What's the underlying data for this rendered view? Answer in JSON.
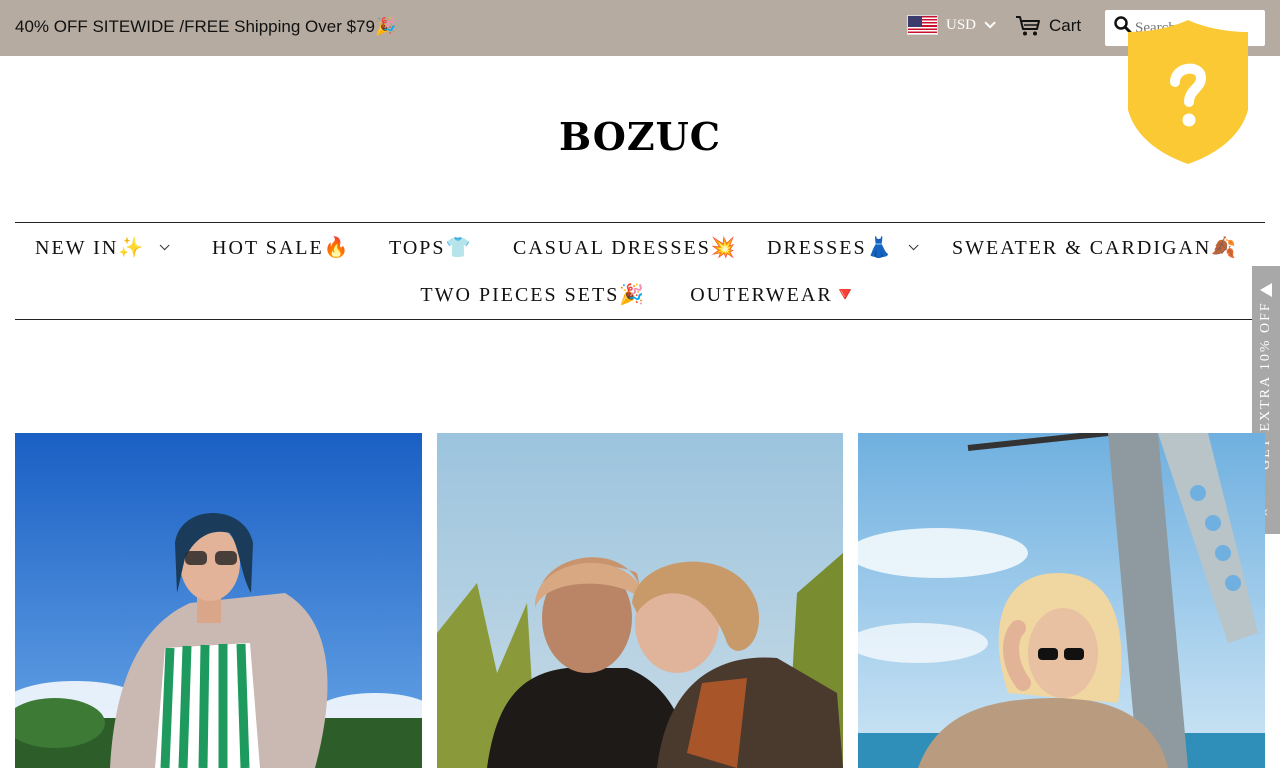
{
  "announcement": {
    "text": "40% OFF SITEWIDE /FREE Shipping Over $79🎉"
  },
  "header": {
    "currency": {
      "selected": "USD",
      "flag_icon": "us-flag-icon"
    },
    "cart": {
      "label": "Cart",
      "icon": "cart-icon"
    },
    "search": {
      "placeholder": "Search",
      "icon": "search-icon"
    }
  },
  "logo": {
    "text": "BOZUC"
  },
  "badge": {
    "symbol": "?",
    "color": "#fbc934",
    "icon": "question-shield-icon"
  },
  "nav": {
    "row1": [
      {
        "label": "NEW IN✨",
        "has_dropdown": true
      },
      {
        "label": "HOT SALE🔥",
        "has_dropdown": false
      },
      {
        "label": "TOPS👕",
        "has_dropdown": false
      },
      {
        "label": "CASUAL DRESSES💥",
        "has_dropdown": false
      },
      {
        "label": "DRESSES👗",
        "has_dropdown": true
      },
      {
        "label": "SWEATER & CARDIGAN🍂",
        "has_dropdown": false
      }
    ],
    "row2": [
      {
        "label": "TWO PIECES SETS🎉",
        "has_dropdown": false
      },
      {
        "label": "OUTERWEAR🔻",
        "has_dropdown": false
      }
    ]
  },
  "side_tab": {
    "text": "GET EXTRA 10% OFF",
    "close": "×",
    "color": "#a8a8a8"
  },
  "products": [
    {
      "name": "product-image-1"
    },
    {
      "name": "product-image-2"
    },
    {
      "name": "product-image-3"
    }
  ],
  "colors": {
    "topbar": "#b5aba0",
    "badge": "#fbc934",
    "sidetab": "#a8a8a8"
  }
}
